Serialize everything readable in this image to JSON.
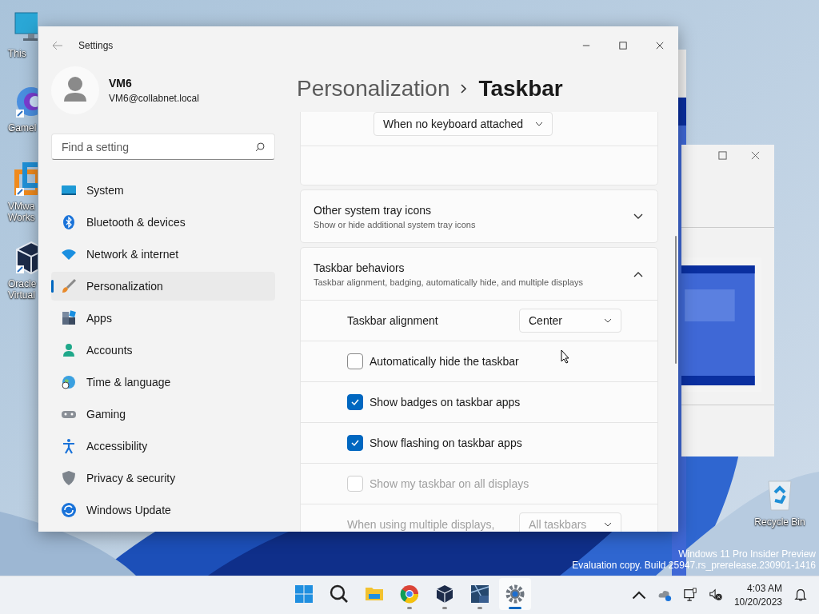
{
  "desktop_icons": [
    {
      "lines": [
        "This"
      ]
    },
    {
      "lines": [
        "Gamel"
      ]
    },
    {
      "lines": [
        "VMwa",
        "Works"
      ]
    },
    {
      "lines": [
        "Oracle",
        "Virtual"
      ]
    },
    {
      "lines": [
        "Recycle Bin"
      ]
    }
  ],
  "window": {
    "title": "Settings"
  },
  "user": {
    "name": "VM6",
    "email": "VM6@collabnet.local"
  },
  "search": {
    "placeholder": "Find a setting"
  },
  "nav": [
    {
      "label": "System",
      "selected": false
    },
    {
      "label": "Bluetooth & devices",
      "selected": false
    },
    {
      "label": "Network & internet",
      "selected": false
    },
    {
      "label": "Personalization",
      "selected": true
    },
    {
      "label": "Apps",
      "selected": false
    },
    {
      "label": "Accounts",
      "selected": false
    },
    {
      "label": "Time & language",
      "selected": false
    },
    {
      "label": "Gaming",
      "selected": false
    },
    {
      "label": "Accessibility",
      "selected": false
    },
    {
      "label": "Privacy & security",
      "selected": false
    },
    {
      "label": "Windows Update",
      "selected": false
    }
  ],
  "breadcrumb": [
    "Personalization",
    "Taskbar"
  ],
  "top_dropdown": {
    "value": "When no keyboard attached"
  },
  "sections": [
    {
      "title": "Other system tray icons",
      "subtitle": "Show or hide additional system tray icons",
      "expanded": false
    },
    {
      "title": "Taskbar behaviors",
      "subtitle": "Taskbar alignment, badging, automatically hide, and multiple displays",
      "expanded": true
    }
  ],
  "behaviors": [
    {
      "kind": "dropdown",
      "label": "Taskbar alignment",
      "value": "Center",
      "disabled": false
    },
    {
      "kind": "checkbox",
      "label": "Automatically hide the taskbar",
      "checked": false,
      "disabled": false
    },
    {
      "kind": "checkbox",
      "label": "Show badges on taskbar apps",
      "checked": true,
      "disabled": false
    },
    {
      "kind": "checkbox",
      "label": "Show flashing on taskbar apps",
      "checked": true,
      "disabled": false
    },
    {
      "kind": "checkbox",
      "label": "Show my taskbar on all displays",
      "checked": false,
      "disabled": true
    },
    {
      "kind": "dropdown",
      "label": "When using multiple displays,",
      "value": "All taskbars",
      "disabled": true
    }
  ],
  "watermark": [
    "Windows 11 Pro Insider Preview",
    "Evaluation copy. Build 25947.rs_prerelease.230901-1416"
  ],
  "taskbar_apps": [
    {
      "running": false,
      "selected": false
    },
    {
      "running": true,
      "selected": false
    },
    {
      "running": true,
      "selected": false
    },
    {
      "running": true,
      "selected": false
    },
    {
      "running": true,
      "selected": true
    }
  ],
  "clock": {
    "time": "4:03 AM",
    "date": "10/20/2023"
  }
}
